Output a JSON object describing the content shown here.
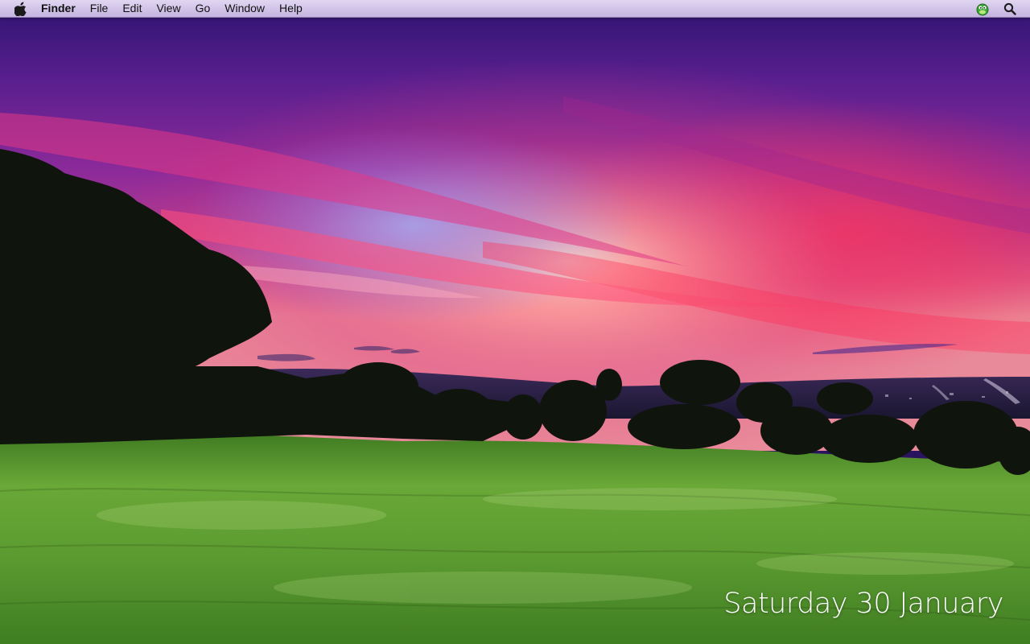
{
  "menubar": {
    "apple_icon": "apple-icon",
    "app_name": "Finder",
    "items": [
      "File",
      "Edit",
      "View",
      "Go",
      "Window",
      "Help"
    ],
    "status_icons": [
      "green-creature-icon",
      "spotlight-search-icon"
    ]
  },
  "desktop": {
    "date_text": "Saturday 30 January",
    "wallpaper": "sunset-over-grassy-field"
  },
  "colors": {
    "sky_top": "#3a1a7a",
    "sky_magenta": "#c0207a",
    "sunset_glow": "#ff6a4a",
    "grass": "#5aa23a"
  }
}
